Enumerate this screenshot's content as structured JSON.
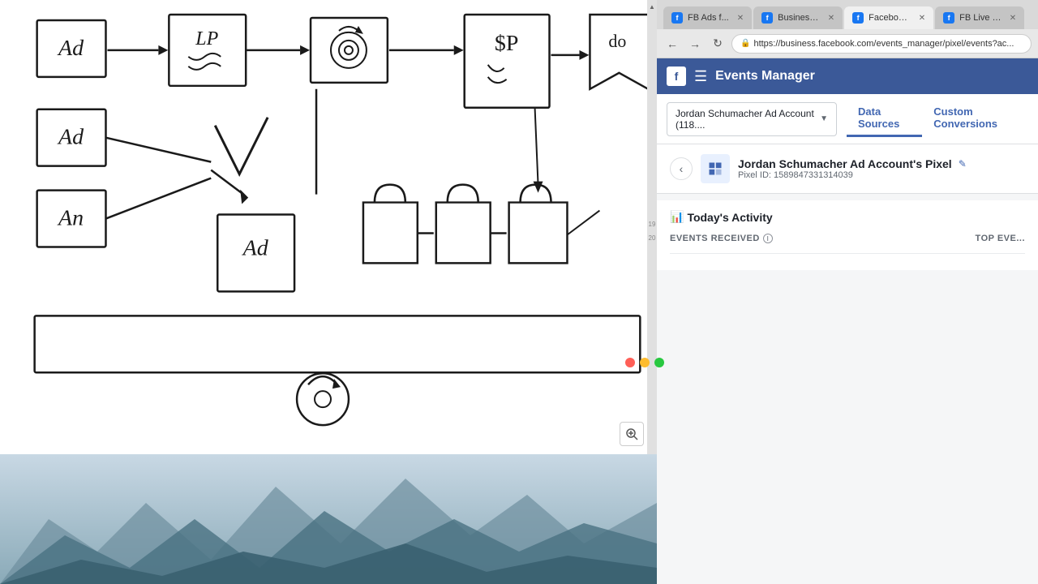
{
  "left_panel": {
    "whiteboard_aria": "Whiteboard drawing area"
  },
  "right_panel": {
    "traffic_lights": {
      "red": "close",
      "yellow": "minimize",
      "green": "maximize"
    },
    "tabs": [
      {
        "id": "tab-fb-ads",
        "label": "FB Ads f...",
        "active": false,
        "favicon_color": "#1877f2"
      },
      {
        "id": "tab-business",
        "label": "Business M...",
        "active": false,
        "favicon_color": "#1877f2"
      },
      {
        "id": "tab-facebook-p",
        "label": "Facebook P...",
        "active": true,
        "favicon_color": "#1877f2"
      },
      {
        "id": "tab-fb-live",
        "label": "FB Live We...",
        "active": false,
        "favicon_color": "#1877f2"
      }
    ],
    "address_bar": {
      "protocol": "Secure",
      "url": "https://business.facebook.com/events_manager/pixel/events?ac..."
    },
    "fb_header": {
      "title": "Events Manager"
    },
    "account_bar": {
      "account_name": "Jordan Schumacher Ad Account (118....",
      "tabs": [
        {
          "label": "Data Sources",
          "active": true
        },
        {
          "label": "Custom Conversions",
          "active": false
        }
      ]
    },
    "pixel": {
      "name": "Jordan Schumacher Ad Account's Pixel",
      "id_label": "Pixel ID: 1589847331314039",
      "back_label": "‹"
    },
    "activity": {
      "title": "Today's Activity",
      "events_received_label": "EVENTS RECEIVED",
      "top_events_label": "TOP EVE..."
    }
  }
}
